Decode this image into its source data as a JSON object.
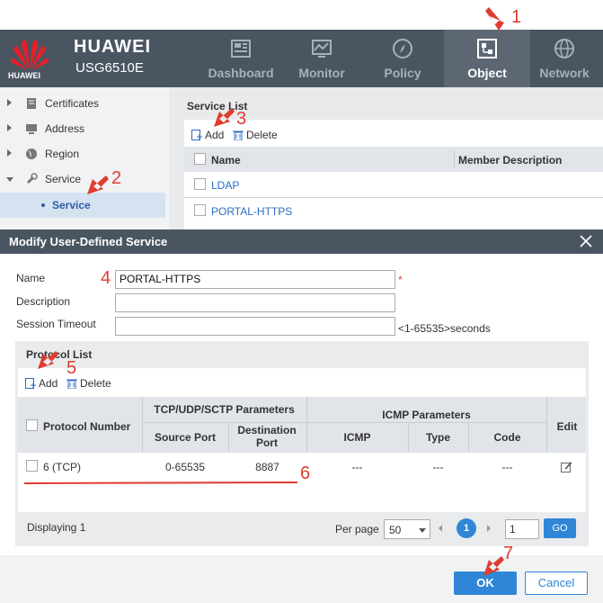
{
  "header": {
    "brand": "HUAWEI",
    "model": "USG6510E",
    "logo_text": "HUAWEI",
    "tabs": [
      {
        "label": "Dashboard",
        "icon": "dashboard-icon"
      },
      {
        "label": "Monitor",
        "icon": "monitor-icon"
      },
      {
        "label": "Policy",
        "icon": "policy-icon"
      },
      {
        "label": "Object",
        "icon": "object-icon",
        "active": true
      },
      {
        "label": "Network",
        "icon": "network-icon"
      }
    ]
  },
  "tree": {
    "items": [
      {
        "label": "Certificates",
        "icon": "certificate-icon"
      },
      {
        "label": "Address",
        "icon": "address-icon"
      },
      {
        "label": "Region",
        "icon": "region-icon"
      },
      {
        "label": "Service",
        "icon": "service-icon",
        "expanded": true
      }
    ],
    "selected_child": "Service"
  },
  "service_list": {
    "title": "Service List",
    "add_label": "Add",
    "delete_label": "Delete",
    "columns": [
      "Name",
      "Member Description"
    ],
    "rows": [
      "LDAP",
      "PORTAL-HTTPS"
    ]
  },
  "dialog": {
    "title": "Modify User-Defined Service",
    "name_label": "Name",
    "name_value": "PORTAL-HTTPS",
    "required_mark": "*",
    "description_label": "Description",
    "description_value": "",
    "timeout_label": "Session Timeout",
    "timeout_value": "",
    "timeout_hint": "<1-65535>seconds",
    "protocol_list": {
      "title": "Protocol List",
      "add_label": "Add",
      "delete_label": "Delete",
      "headers": {
        "protocol_number": "Protocol Number",
        "tcp_group": "TCP/UDP/SCTP Parameters",
        "source_port": "Source Port",
        "destination_port": "Destination Port",
        "icmp_group": "ICMP Parameters",
        "icmp": "ICMP",
        "type": "Type",
        "code": "Code",
        "edit": "Edit"
      },
      "row": {
        "protocol": "6 (TCP)",
        "source_port": "0-65535",
        "destination_port": "8887",
        "icmp": "---",
        "type": "---",
        "code": "---"
      },
      "pager": {
        "displaying": "Displaying 1",
        "per_page_label": "Per page",
        "per_page_value": "50",
        "current_page": "1",
        "page_input": "1",
        "go_label": "GO"
      }
    },
    "ok_label": "OK",
    "cancel_label": "Cancel"
  },
  "annotations": [
    "1",
    "2",
    "3",
    "4",
    "5",
    "6",
    "7"
  ],
  "colors": {
    "header_bg": "#4a5562",
    "accent_blue": "#2f86d6",
    "annotation_red": "#e03c2f",
    "link_blue": "#2b6cc4"
  }
}
